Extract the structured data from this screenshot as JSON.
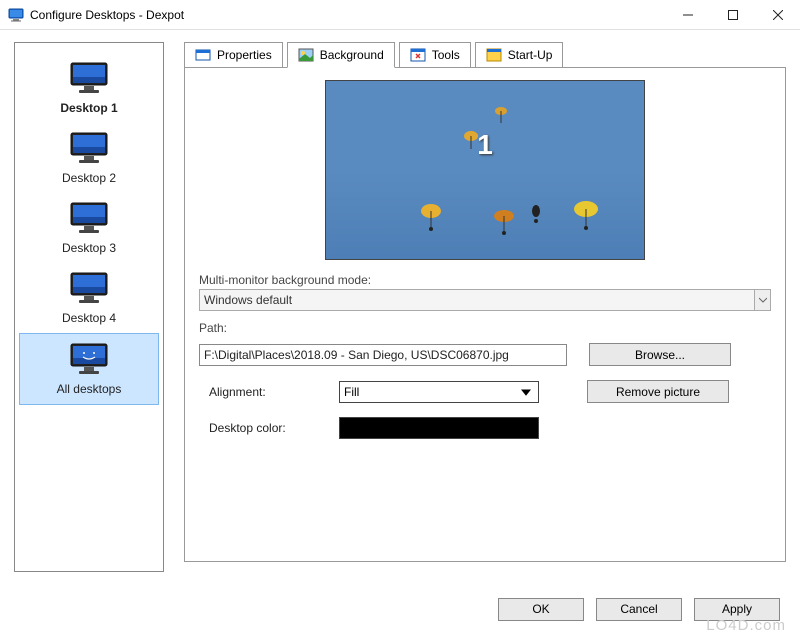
{
  "titlebar": {
    "title": "Configure Desktops - Dexpot"
  },
  "sidebar": {
    "items": [
      {
        "label": "Desktop 1"
      },
      {
        "label": "Desktop 2"
      },
      {
        "label": "Desktop 3"
      },
      {
        "label": "Desktop 4"
      },
      {
        "label": "All desktops"
      }
    ]
  },
  "tabs": {
    "items": [
      {
        "label": "Properties"
      },
      {
        "label": "Background"
      },
      {
        "label": "Tools"
      },
      {
        "label": "Start-Up"
      }
    ]
  },
  "panel": {
    "preview_number": "1",
    "multi_monitor_label": "Multi-monitor background mode:",
    "multi_monitor_value": "Windows default",
    "path_label": "Path:",
    "path_value": "F:\\Digital\\Places\\2018.09 - San Diego, US\\DSC06870.jpg",
    "browse_label": "Browse...",
    "alignment_label": "Alignment:",
    "alignment_value": "Fill",
    "remove_label": "Remove picture",
    "desktop_color_label": "Desktop color:",
    "desktop_color_value": "#000000"
  },
  "buttons": {
    "ok": "OK",
    "cancel": "Cancel",
    "apply": "Apply"
  },
  "watermark": "LO4D.com"
}
